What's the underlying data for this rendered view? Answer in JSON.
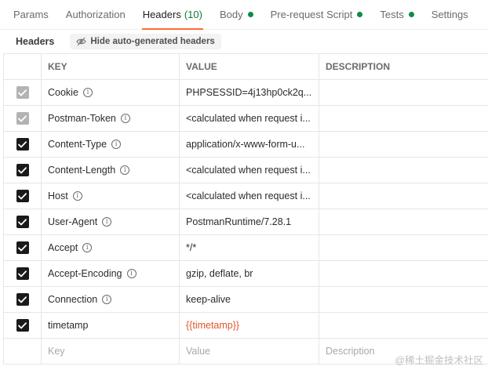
{
  "tabs": [
    {
      "label": "Params",
      "count": "",
      "dot": false,
      "active": false
    },
    {
      "label": "Authorization",
      "count": "",
      "dot": false,
      "active": false
    },
    {
      "label": "Headers",
      "count": "(10)",
      "dot": false,
      "active": true
    },
    {
      "label": "Body",
      "count": "",
      "dot": true,
      "active": false
    },
    {
      "label": "Pre-request Script",
      "count": "",
      "dot": true,
      "active": false
    },
    {
      "label": "Tests",
      "count": "",
      "dot": true,
      "active": false
    },
    {
      "label": "Settings",
      "count": "",
      "dot": false,
      "active": false
    }
  ],
  "subbar": {
    "title": "Headers",
    "hide_button": "Hide auto-generated headers",
    "hide_icon": "eye-off-icon"
  },
  "table": {
    "columns": {
      "key": "KEY",
      "value": "VALUE",
      "description": "DESCRIPTION"
    },
    "rows": [
      {
        "checked": "dim",
        "key": "Cookie",
        "info": true,
        "value": "PHPSESSID=4j13hp0ck2q...",
        "is_var": false
      },
      {
        "checked": "dim",
        "key": "Postman-Token",
        "info": true,
        "value": "<calculated when request i...",
        "is_var": false
      },
      {
        "checked": "on",
        "key": "Content-Type",
        "info": true,
        "value": "application/x-www-form-u...",
        "is_var": false
      },
      {
        "checked": "on",
        "key": "Content-Length",
        "info": true,
        "value": "<calculated when request i...",
        "is_var": false
      },
      {
        "checked": "on",
        "key": "Host",
        "info": true,
        "value": "<calculated when request i...",
        "is_var": false
      },
      {
        "checked": "on",
        "key": "User-Agent",
        "info": true,
        "value": "PostmanRuntime/7.28.1",
        "is_var": false
      },
      {
        "checked": "on",
        "key": "Accept",
        "info": true,
        "value": "*/*",
        "is_var": false
      },
      {
        "checked": "on",
        "key": "Accept-Encoding",
        "info": true,
        "value": "gzip, deflate, br",
        "is_var": false
      },
      {
        "checked": "on",
        "key": "Connection",
        "info": true,
        "value": "keep-alive",
        "is_var": false
      },
      {
        "checked": "on",
        "key": "timetamp",
        "info": false,
        "value": "{{timetamp}}",
        "is_var": true
      }
    ],
    "placeholders": {
      "key": "Key",
      "value": "Value",
      "description": "Description"
    }
  },
  "watermark": "@稀土掘金技术社区",
  "colors": {
    "accent": "#ff6c37",
    "status_dot": "#0f8a47",
    "variable": "#e0552a"
  }
}
